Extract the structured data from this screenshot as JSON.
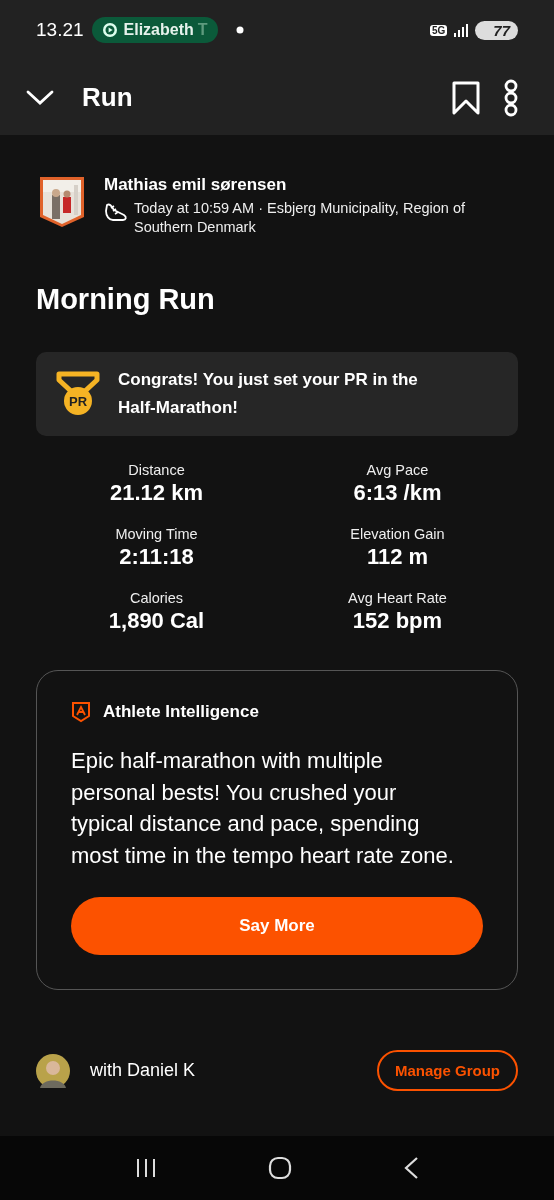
{
  "status_bar": {
    "time": "13.21",
    "call_pill": {
      "name": "Elizabeth",
      "fade": "T"
    },
    "network": "5G",
    "battery": "77"
  },
  "header": {
    "title": "Run"
  },
  "athlete": {
    "name": "Mathias emil sørensen",
    "meta": "Today at 10:59 AM · Esbjerg Municipality, Region of Southern Denmark"
  },
  "activity_title": "Morning Run",
  "pr_banner": {
    "badge": "PR",
    "text": "Congrats! You just set your PR in the Half-Marathon!"
  },
  "stats": [
    {
      "label": "Distance",
      "value": "21.12 km"
    },
    {
      "label": "Avg Pace",
      "value": "6:13 /km"
    },
    {
      "label": "Moving Time",
      "value": "2:11:18"
    },
    {
      "label": "Elevation Gain",
      "value": "112 m"
    },
    {
      "label": "Calories",
      "value": "1,890 Cal"
    },
    {
      "label": "Avg Heart Rate",
      "value": "152 bpm"
    }
  ],
  "intelligence": {
    "title": "Athlete Intelligence",
    "summary": "Epic half-marathon with multiple personal bests! You crushed your typical distance and pace, spending most time in the tempo heart rate zone.",
    "button": "Say More"
  },
  "group": {
    "text": "with Daniel K",
    "button": "Manage Group"
  }
}
